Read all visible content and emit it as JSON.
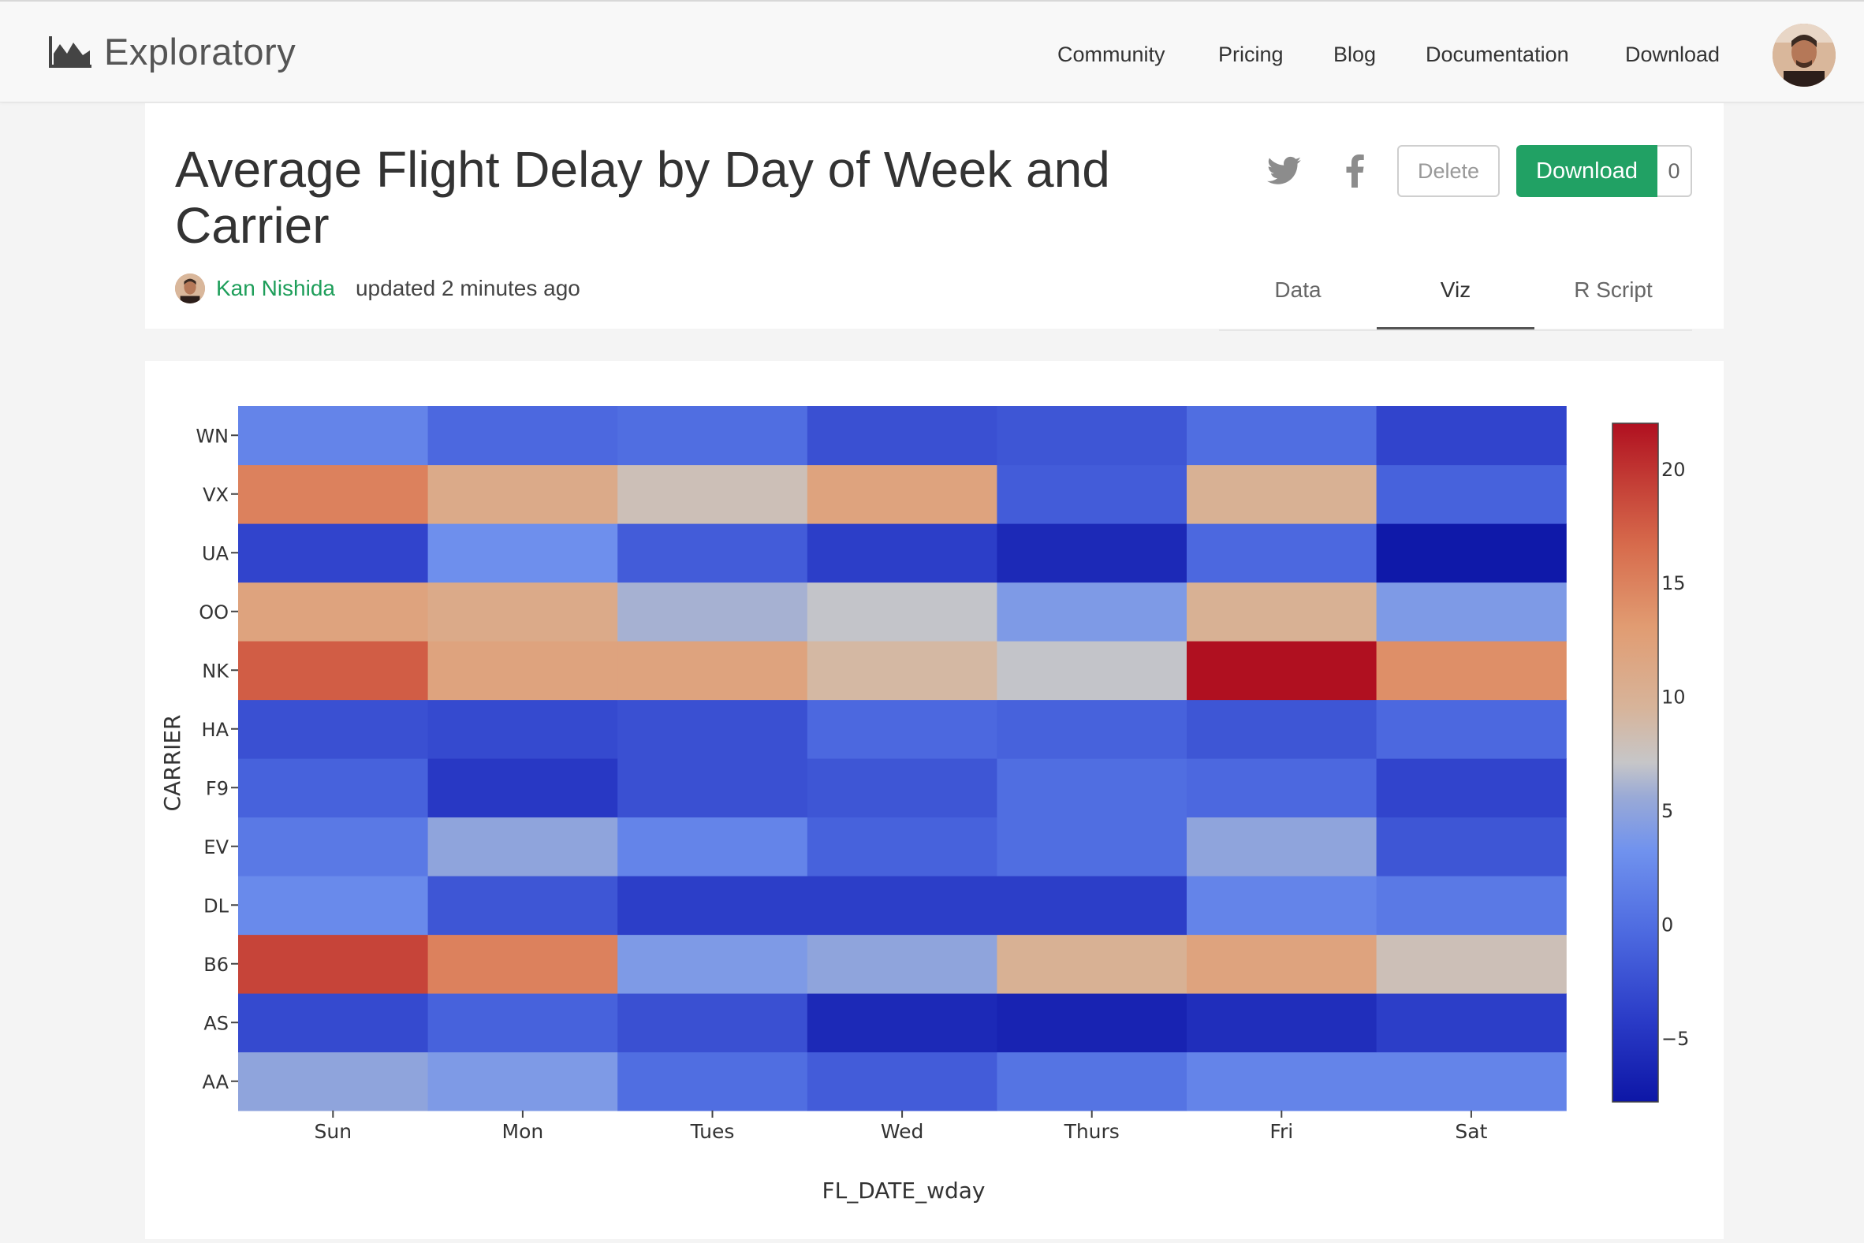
{
  "app": {
    "name": "Exploratory"
  },
  "nav": {
    "items": [
      "Community",
      "Pricing",
      "Blog",
      "Documentation",
      "Download"
    ]
  },
  "page": {
    "title_line1": "Average Flight Delay by Day of Week and",
    "title_line2": "Carrier",
    "author": "Kan Nishida",
    "updated": "updated 2 minutes ago"
  },
  "actions": {
    "delete_label": "Delete",
    "download_label": "Download",
    "download_count": "0"
  },
  "icons": {
    "twitter": "twitter-icon",
    "facebook": "facebook-icon",
    "logo": "area-chart-logo-icon"
  },
  "tabs": [
    {
      "label": "Data",
      "active": false
    },
    {
      "label": "Viz",
      "active": true
    },
    {
      "label": "R Script",
      "active": false
    }
  ],
  "colors": {
    "accent_green": "#21a164",
    "author_green": "#1e9e5a",
    "colorscale": [
      [
        0.0,
        "#0d16a6"
      ],
      [
        0.12,
        "#2a3bc7"
      ],
      [
        0.25,
        "#4d6ae0"
      ],
      [
        0.37,
        "#7092ee"
      ],
      [
        0.45,
        "#9aaad6"
      ],
      [
        0.5,
        "#c6c6c8"
      ],
      [
        0.58,
        "#d7b49a"
      ],
      [
        0.7,
        "#e19c72"
      ],
      [
        0.82,
        "#d76b4c"
      ],
      [
        0.92,
        "#c23a34"
      ],
      [
        1.0,
        "#b01020"
      ]
    ]
  },
  "chart_data": {
    "type": "heatmap",
    "title": "",
    "xlabel": "FL_DATE_wday",
    "ylabel": "CARRIER",
    "x": [
      "Sun",
      "Mon",
      "Tues",
      "Wed",
      "Thurs",
      "Fri",
      "Sat"
    ],
    "y": [
      "AA",
      "AS",
      "B6",
      "DL",
      "EV",
      "F9",
      "HA",
      "NK",
      "OO",
      "UA",
      "VX",
      "WN"
    ],
    "z": [
      [
        5,
        4,
        0,
        -1.5,
        0.5,
        2,
        2
      ],
      [
        -3,
        -1,
        -2.5,
        -6,
        -6.5,
        -5.5,
        -4
      ],
      [
        19,
        15,
        4,
        5,
        10,
        12,
        8
      ],
      [
        2.5,
        -2,
        -4,
        -4,
        -4,
        2,
        1
      ],
      [
        1,
        5,
        2,
        -1,
        0,
        5,
        -2
      ],
      [
        -1,
        -4.5,
        -2.5,
        -2,
        0,
        -0.5,
        -3.5
      ],
      [
        -2.5,
        -3,
        -2.5,
        -0.5,
        -1,
        -2,
        -0.5
      ],
      [
        17.5,
        12,
        12,
        9,
        7,
        22,
        14
      ],
      [
        12,
        11,
        6,
        7,
        4,
        10,
        4
      ],
      [
        -3.5,
        3,
        -1.5,
        -4,
        -6,
        -0.5,
        -7.5
      ],
      [
        15,
        11,
        8,
        12,
        -1.5,
        10,
        -1
      ],
      [
        2,
        -0.5,
        0,
        -2.5,
        -2,
        0,
        -3.5
      ]
    ],
    "zmin": -7.8,
    "zmax": 22,
    "colorbar_ticks": [
      -5,
      0,
      5,
      10,
      15,
      20
    ],
    "colorbar_tick_labels": [
      "−5",
      "0",
      "5",
      "10",
      "15",
      "20"
    ],
    "colorscale": "blue-to-red diverging"
  }
}
